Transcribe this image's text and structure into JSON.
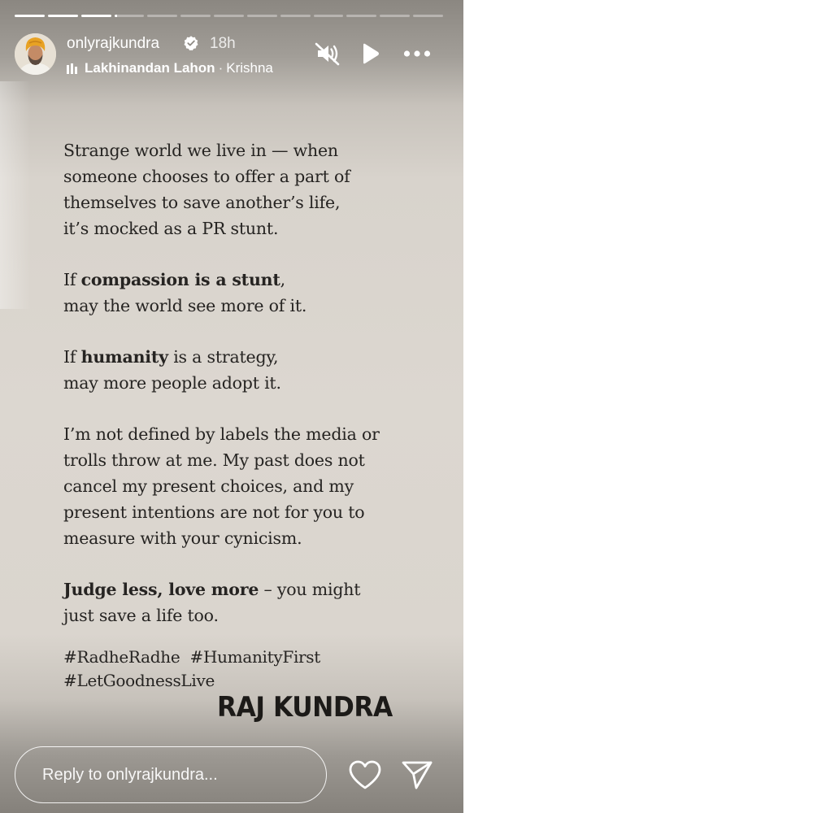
{
  "story": {
    "progress_segments": [
      1,
      1,
      1,
      0.1,
      0,
      0,
      0,
      0,
      0,
      0,
      0,
      0,
      0
    ],
    "username": "onlyrajkundra",
    "verified": true,
    "time_ago": "18h",
    "music": {
      "artist": "Lakhinandan Lahon",
      "separator": "·",
      "title": "Krishna"
    },
    "icons": {
      "verified": "verified-badge-icon",
      "music": "music-bars-icon",
      "mute": "muted-speaker-icon",
      "play": "play-icon",
      "more": "more-options-icon",
      "like": "heart-icon",
      "send": "send-paper-plane-icon"
    }
  },
  "post": {
    "p1": {
      "lines": [
        "Strange world we live in — when",
        "someone chooses to offer a part of",
        "themselves to save another’s life,",
        "it’s mocked as a PR stunt."
      ]
    },
    "p2": {
      "l1_pre": "If ",
      "l1_bold": "compassion is a stunt",
      "l1_post": ",",
      "l2": "may the world see more of it."
    },
    "p3": {
      "l1_pre": "If ",
      "l1_bold": "humanity",
      "l1_post": " is a strategy,",
      "l2": "may more people adopt it."
    },
    "p4": {
      "lines": [
        "I’m not defined by labels the media or",
        "trolls throw at me. My past does not",
        "cancel my present choices, and my",
        "present intentions are not for you to",
        "measure with your cynicism."
      ]
    },
    "p5": {
      "l1_bold": "Judge less, love more",
      "l1_post": " – you might",
      "l2": "just save a life too."
    },
    "hashtags": {
      "line1": "#RadheRadhe  #HumanityFirst",
      "line2": "#LetGoodnessLive"
    },
    "signature": "RAJ KUNDRA"
  },
  "footer": {
    "reply_placeholder": "Reply to onlyrajkundra..."
  },
  "colors": {
    "text": "#262422",
    "overlay_text": "#ffffff",
    "avatar_turban": "#e8a224"
  }
}
